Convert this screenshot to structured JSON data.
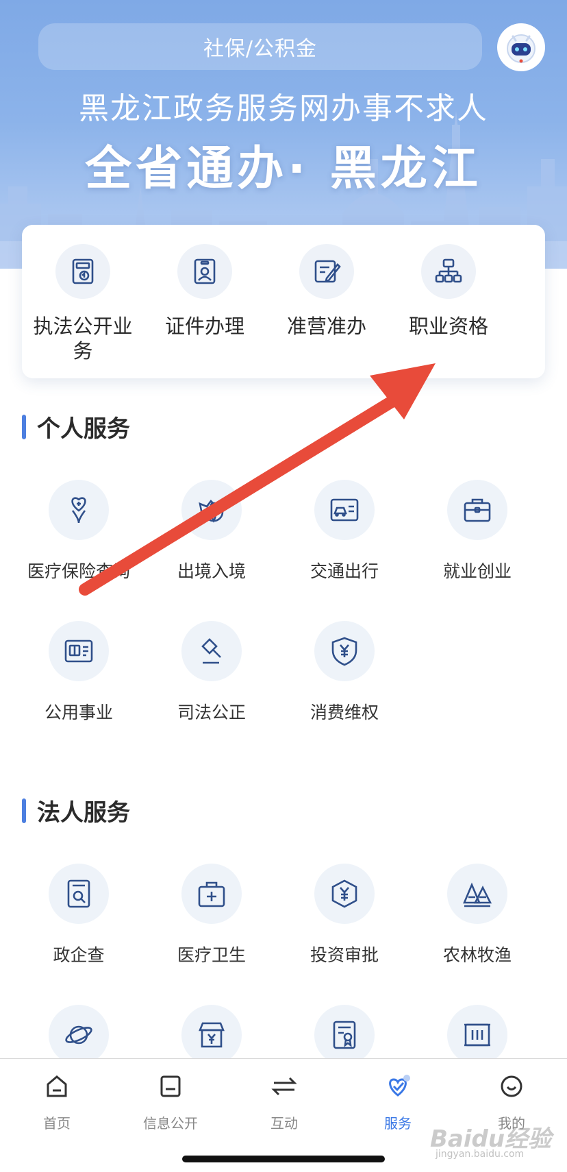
{
  "banner": {
    "search_text": "社保/公积金",
    "slogan_line1": "黑龙江政务服务网办事不求人",
    "slogan_line2": "全省通办· 黑龙江"
  },
  "quick_services": [
    {
      "label": "执法公开业务",
      "icon": "document-refresh-icon"
    },
    {
      "label": "证件办理",
      "icon": "id-card-person-icon"
    },
    {
      "label": "准营准办",
      "icon": "edit-document-icon"
    },
    {
      "label": "职业资格",
      "icon": "org-chart-icon"
    }
  ],
  "personal_services": {
    "title": "个人服务",
    "items": [
      {
        "label": "医疗保险查询",
        "icon": "medical-heart-icon"
      },
      {
        "label": "出境入境",
        "icon": "plane-globe-icon"
      },
      {
        "label": "交通出行",
        "icon": "car-card-icon"
      },
      {
        "label": "就业创业",
        "icon": "briefcase-icon"
      },
      {
        "label": "公用事业",
        "icon": "utility-card-icon"
      },
      {
        "label": "司法公正",
        "icon": "gavel-icon"
      },
      {
        "label": "消费维权",
        "icon": "yuan-shield-icon"
      }
    ]
  },
  "corporate_services": {
    "title": "法人服务",
    "items": [
      {
        "label": "政企查",
        "icon": "document-search-icon"
      },
      {
        "label": "医疗卫生",
        "icon": "medical-kit-icon"
      },
      {
        "label": "投资审批",
        "icon": "yuan-hexagon-icon"
      },
      {
        "label": "农林牧渔",
        "icon": "trees-icon"
      },
      {
        "label": "",
        "icon": "planet-icon"
      },
      {
        "label": "",
        "icon": "shop-yuan-icon"
      },
      {
        "label": "",
        "icon": "certificate-icon"
      },
      {
        "label": "",
        "icon": "gate-icon"
      }
    ]
  },
  "bottom_nav": [
    {
      "label": "首页",
      "icon": "home-icon",
      "active": false
    },
    {
      "label": "信息公开",
      "icon": "notice-icon",
      "active": false
    },
    {
      "label": "互动",
      "icon": "exchange-icon",
      "active": false
    },
    {
      "label": "服务",
      "icon": "service-heart-icon",
      "active": true
    },
    {
      "label": "我的",
      "icon": "profile-smile-icon",
      "active": false
    }
  ],
  "watermark": {
    "text": "Baidu经验",
    "sub": "jingyan.baidu.com"
  },
  "colors": {
    "accent": "#3a78e6",
    "section_bar": "#4d7fe0",
    "icon_stroke": "#2f4f8a",
    "arrow": "#e84b3a",
    "banner_top": "#7fa9e6"
  }
}
